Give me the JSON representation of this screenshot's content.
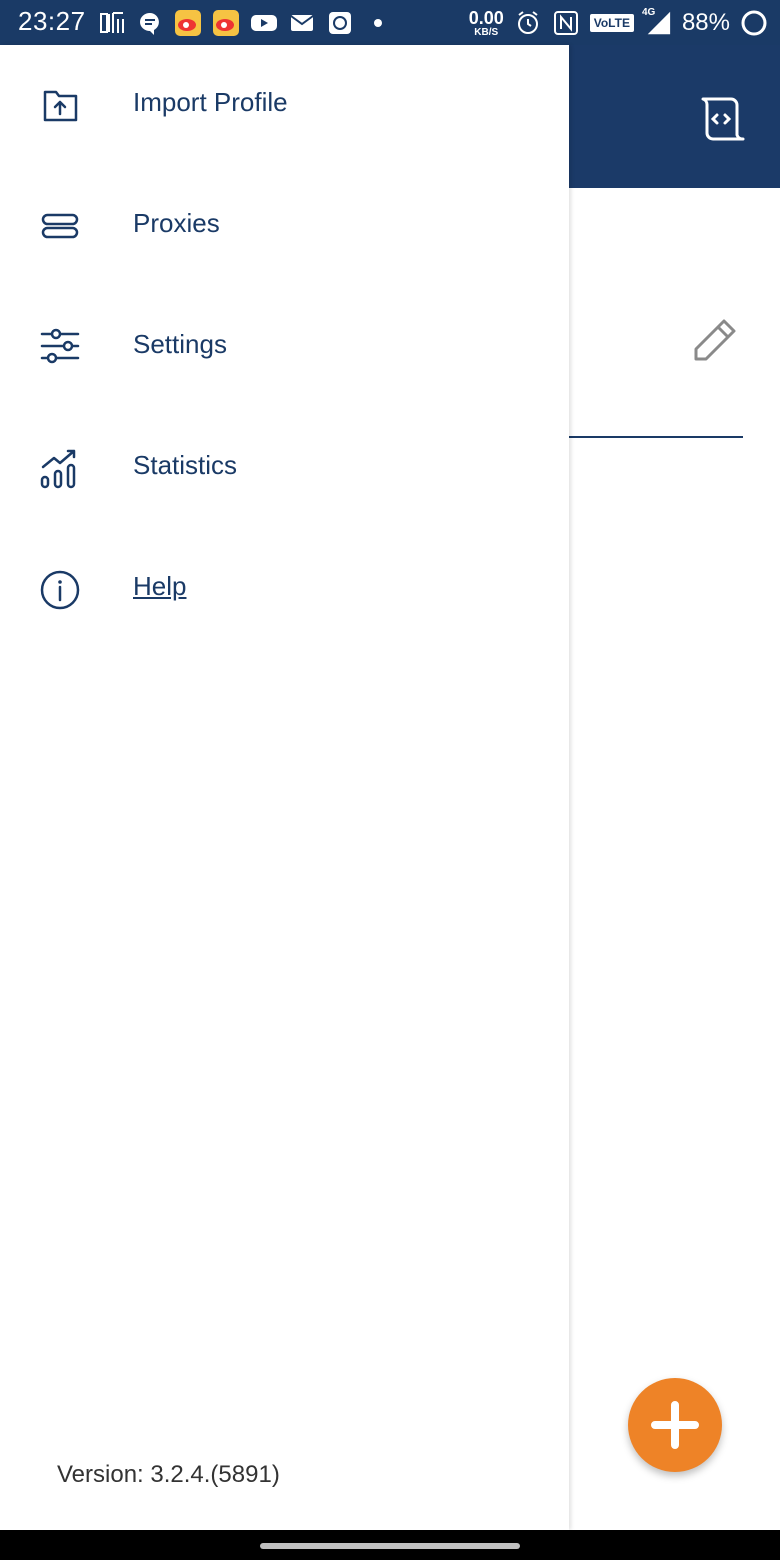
{
  "status_bar": {
    "time": "23:27",
    "notification_icons": [
      "listen-app-icon",
      "message-icon",
      "weibo-icon",
      "weibo-icon",
      "youtube-icon",
      "mail-icon",
      "app-icon",
      "dot-icon"
    ],
    "net_speed_value": "0.00",
    "net_speed_unit": "KB/S",
    "volte_label": "VoLTE",
    "network_label": "4G",
    "battery_percent": "88%"
  },
  "drawer": {
    "items": [
      {
        "label": "Import Profile",
        "icon": "import-icon"
      },
      {
        "label": "Proxies",
        "icon": "proxies-icon"
      },
      {
        "label": "Settings",
        "icon": "settings-icon"
      },
      {
        "label": "Statistics",
        "icon": "statistics-icon"
      },
      {
        "label": "Help",
        "icon": "help-icon"
      }
    ],
    "version": "Version: 3.2.4.(5891)"
  },
  "colors": {
    "primary": "#1a3a66",
    "accent": "#ee8327"
  }
}
